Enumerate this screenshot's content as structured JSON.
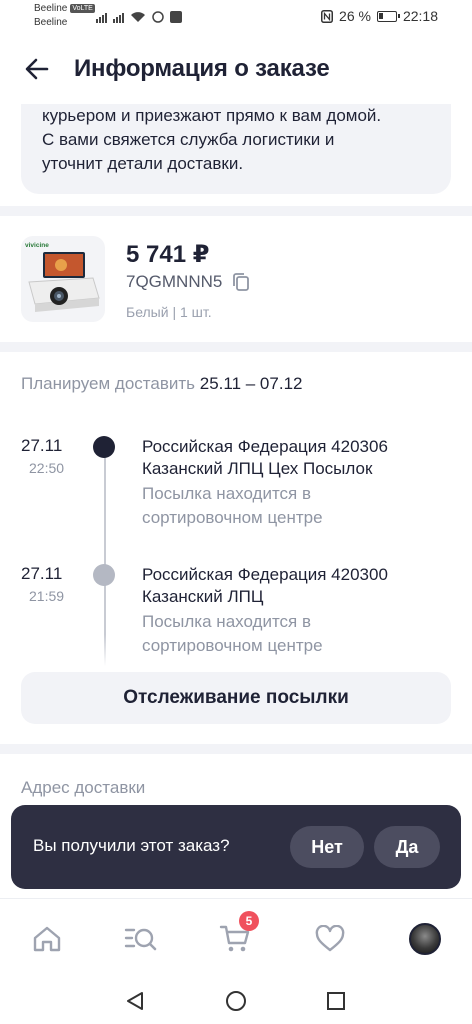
{
  "status_bar": {
    "carrier_1": "Beeline",
    "volte_badge": "VoLTE",
    "carrier_2": "Beeline",
    "battery": "26 %",
    "time": "22:18"
  },
  "header": {
    "title": "Информация о заказе"
  },
  "info_card": {
    "text_line_1": "курьером и приезжают прямо к вам домой.",
    "text_line_2": "С вами свяжется служба логистики и",
    "text_line_3": "уточнит детали доставки."
  },
  "product": {
    "image_brand": "vivicine",
    "price": "5 741 ₽",
    "code": "7QGMNNN5",
    "variant": "Белый | 1 шт."
  },
  "delivery": {
    "plan_label": "Планируем доставить",
    "plan_dates": "25.11 – 07.12",
    "events": [
      {
        "date": "27.11",
        "time": "22:50",
        "place_line_1": "Российская Федерация 420306",
        "place_line_2": "Казанский ЛПЦ Цех Посылок",
        "status_line_1": "Посылка находится в",
        "status_line_2": "сортировочном центре",
        "dot_color": "#1f2235"
      },
      {
        "date": "27.11",
        "time": "21:59",
        "place_line_1": "Российская Федерация 420300",
        "place_line_2": "Казанский ЛПЦ",
        "status_line_1": "Посылка находится в",
        "status_line_2": "сортировочном центре",
        "dot_color": "#b4b8c3"
      }
    ],
    "track_button": "Отслеживание посылки"
  },
  "address": {
    "label": "Адрес доставки"
  },
  "snackbar": {
    "question": "Вы получили этот заказ?",
    "no_label": "Нет",
    "yes_label": "Да"
  },
  "bottom_nav": {
    "cart_count": "5",
    "items": [
      "home-icon",
      "catalog-search-icon",
      "cart-icon",
      "heart-icon",
      "profile-avatar"
    ]
  },
  "system_nav": [
    "back-triangle-icon",
    "home-circle-icon",
    "recents-square-icon"
  ],
  "colors": {
    "text_primary": "#1f2235",
    "text_secondary": "#8f95a3",
    "card_bg": "#f2f3f7",
    "snackbar_bg": "#2e2f42",
    "badge": "#f0515d"
  }
}
